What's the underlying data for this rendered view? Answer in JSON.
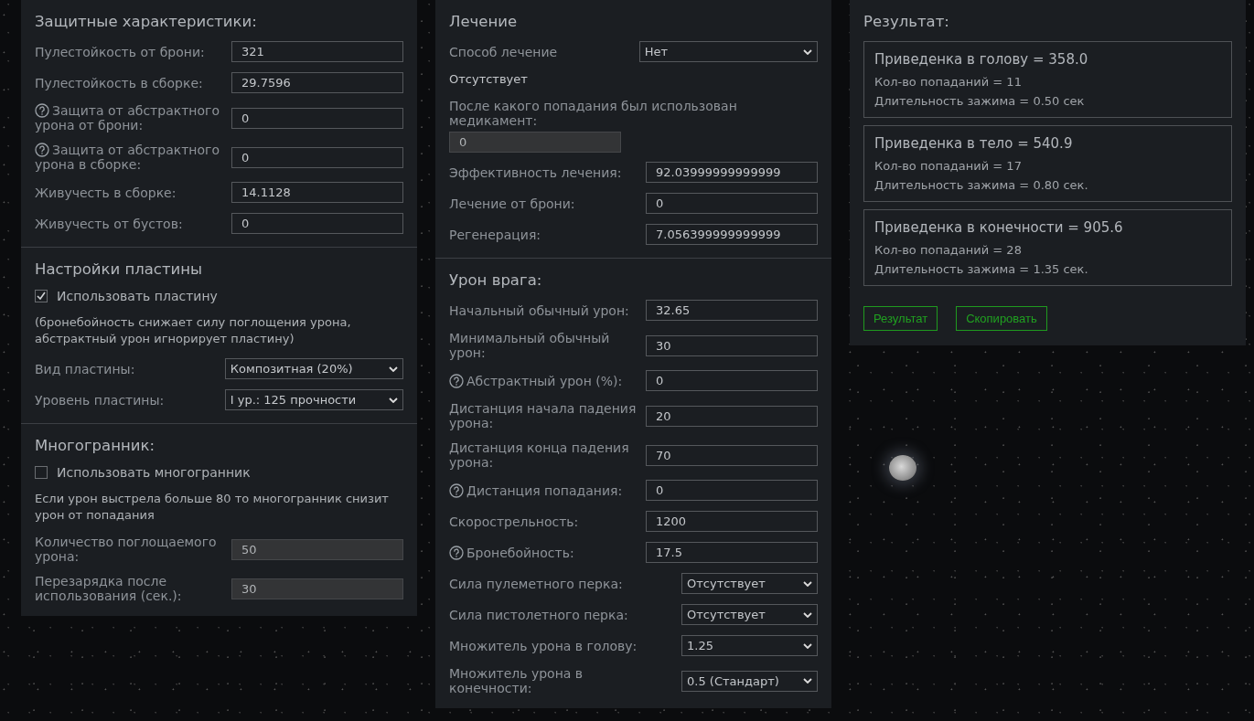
{
  "columns": [
    {
      "sections": [
        {
          "title": "Защитные характеристики:",
          "items": [
            {
              "kind": "field",
              "label": "Пулестойкость от брони:",
              "value": "321",
              "disabled": false,
              "help": false
            },
            {
              "kind": "field",
              "label": "Пулестойкость в сборке:",
              "value": "29.7596",
              "disabled": false,
              "help": false
            },
            {
              "kind": "field",
              "label": "Защита от абстрактного урона от брони:",
              "value": "0",
              "disabled": false,
              "help": true
            },
            {
              "kind": "field",
              "label": "Защита от абстрактного урона в сборке:",
              "value": "0",
              "disabled": false,
              "help": true
            },
            {
              "kind": "field",
              "label": "Живучесть в сборке:",
              "value": "14.1128",
              "disabled": false,
              "help": false
            },
            {
              "kind": "field",
              "label": "Живучесть от бустов:",
              "value": "0",
              "disabled": false,
              "help": false
            }
          ]
        },
        {
          "title": "Настройки пластины",
          "items": [
            {
              "kind": "checkbox",
              "label": "Использовать пластину",
              "checked": true
            },
            {
              "kind": "note",
              "text": "(бронебойность снижает силу поглощения урона, абстрактный урон игнорирует пластину)"
            },
            {
              "kind": "select",
              "label": "Вид пластины:",
              "value": "Композитная (20%)"
            },
            {
              "kind": "select",
              "label": "Уровень пластины:",
              "value": "I ур.: 125 прочности"
            }
          ]
        },
        {
          "title": "Многогранник:",
          "items": [
            {
              "kind": "checkbox",
              "label": "Использовать многогранник",
              "checked": false
            },
            {
              "kind": "note",
              "text": "Если урон выстрела больше 80 то многогранник снизит урон от попадания"
            },
            {
              "kind": "field",
              "label": "Количество поглощаемого урона:",
              "value": "50",
              "disabled": true,
              "help": false
            },
            {
              "kind": "field",
              "label": "Перезарядка после использования (сек.):",
              "value": "30",
              "disabled": true,
              "help": false
            }
          ]
        }
      ]
    },
    {
      "sections": [
        {
          "title": "Лечение",
          "items": [
            {
              "kind": "select",
              "label": "Способ лечение",
              "value": "Нет"
            },
            {
              "kind": "status",
              "text": "Отсутствует"
            },
            {
              "kind": "stacked-field",
              "label": "После какого попадания был использован медикамент:",
              "value": "0",
              "disabled": true
            },
            {
              "kind": "field",
              "label": "Эффективность лечения:",
              "value": "92.03999999999999",
              "disabled": false,
              "help": false
            },
            {
              "kind": "field",
              "label": "Лечение от брони:",
              "value": "0",
              "disabled": false,
              "help": false
            },
            {
              "kind": "field",
              "label": "Регенерация:",
              "value": "7.056399999999999",
              "disabled": false,
              "help": false
            }
          ]
        },
        {
          "title": "Урон врага:",
          "items": [
            {
              "kind": "field",
              "label": "Начальный обычный урон:",
              "value": "32.65",
              "disabled": false,
              "help": false
            },
            {
              "kind": "field",
              "label": "Минимальный обычный урон:",
              "value": "30",
              "disabled": false,
              "help": false
            },
            {
              "kind": "field",
              "label": "Абстрактный урон (%):",
              "value": "0",
              "disabled": false,
              "help": true
            },
            {
              "kind": "field",
              "label": "Дистанция начала падения урона:",
              "value": "20",
              "disabled": false,
              "help": false
            },
            {
              "kind": "field",
              "label": "Дистанция конца падения урона:",
              "value": "70",
              "disabled": false,
              "help": false
            },
            {
              "kind": "field",
              "label": "Дистанция попадания:",
              "value": "0",
              "disabled": false,
              "help": true
            },
            {
              "kind": "field",
              "label": "Скорострельность:",
              "value": "1200",
              "disabled": false,
              "help": false
            },
            {
              "kind": "field",
              "label": "Бронебойность:",
              "value": "17.5",
              "disabled": false,
              "help": true
            },
            {
              "kind": "select",
              "label": "Сила пулеметного перка:",
              "value": "Отсутствует"
            },
            {
              "kind": "select",
              "label": "Сила пистолетного перка:",
              "value": "Отсутствует"
            },
            {
              "kind": "select",
              "label": "Множитель урона в голову:",
              "value": "1.25"
            },
            {
              "kind": "select",
              "label": "Множитель урона в конечности:",
              "value": "0.5 (Стандарт)"
            }
          ]
        }
      ]
    }
  ],
  "result": {
    "title": "Результат:",
    "cards": [
      {
        "title": "Приведенка в голову = 358.0",
        "lines": [
          "Кол-во попаданий = 11",
          "Длительность зажима = 0.50 сек"
        ]
      },
      {
        "title": "Приведенка в тело = 540.9",
        "lines": [
          "Кол-во попаданий = 17",
          "Длительность зажима = 0.80 сек."
        ]
      },
      {
        "title": "Приведенка в конечности = 905.6",
        "lines": [
          "Кол-во попаданий = 28",
          "Длительность зажима = 1.35 сек."
        ]
      }
    ],
    "buttons": [
      "Результат",
      "Скопировать"
    ]
  }
}
